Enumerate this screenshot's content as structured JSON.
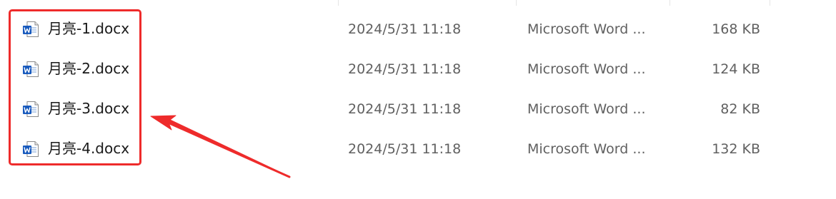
{
  "files": [
    {
      "name": "月亮-1.docx",
      "modified": "2024/5/31 11:18",
      "type": "Microsoft Word ...",
      "size": "168 KB",
      "icon": "word-document-icon"
    },
    {
      "name": "月亮-2.docx",
      "modified": "2024/5/31 11:18",
      "type": "Microsoft Word ...",
      "size": "124 KB",
      "icon": "word-document-icon"
    },
    {
      "name": "月亮-3.docx",
      "modified": "2024/5/31 11:18",
      "type": "Microsoft Word ...",
      "size": "82 KB",
      "icon": "word-document-icon"
    },
    {
      "name": "月亮-4.docx",
      "modified": "2024/5/31 11:18",
      "type": "Microsoft Word ...",
      "size": "132 KB",
      "icon": "word-document-icon"
    }
  ],
  "colors": {
    "annotation": "#ee2b2b",
    "word_blue": "#185abd",
    "secondary_text": "#606060"
  }
}
